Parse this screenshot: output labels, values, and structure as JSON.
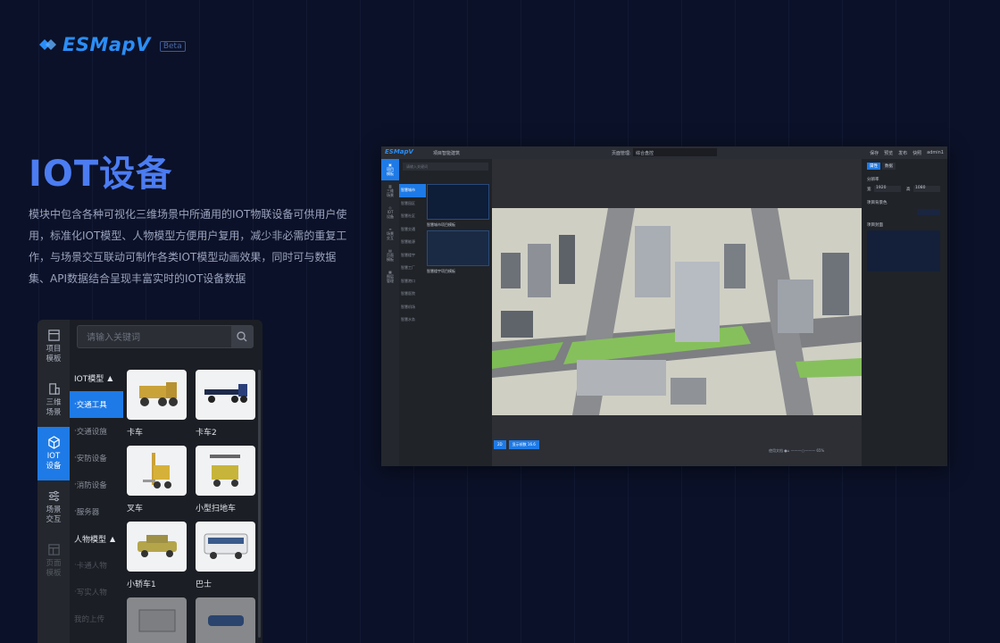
{
  "brand": {
    "name": "ESMapV",
    "badge": "Beta"
  },
  "page": {
    "title": "IOT设备",
    "description": "模块中包含各种可视化三维场景中所通用的IOT物联设备可供用户使用，标准化IOT模型、人物模型方便用户复用，减少非必需的重复工作，与场景交互联动可制作各类IOT模型动画效果，同时可与数据集、API数据结合呈现丰富实时的IOT设备数据"
  },
  "panel": {
    "search_placeholder": "请输入关键词",
    "rail": [
      {
        "label1": "项目",
        "label2": "模板"
      },
      {
        "label1": "三维",
        "label2": "场景"
      },
      {
        "label1": "IOT",
        "label2": "设备"
      },
      {
        "label1": "场景",
        "label2": "交互"
      },
      {
        "label1": "页面",
        "label2": "模板"
      }
    ],
    "groups": {
      "iot": {
        "label": "IOT模型",
        "caret": "▲"
      },
      "people": {
        "label": "人物模型",
        "caret": "▲"
      }
    },
    "iot_items": [
      "交通工具",
      "交通设施",
      "安防设备",
      "消防设备",
      "服务器"
    ],
    "people_items": [
      "卡通人物",
      "写实人物",
      "我的上传"
    ],
    "models": [
      "卡车",
      "卡车2",
      "叉车",
      "小型扫地车",
      "小轿车1",
      "巴士"
    ]
  },
  "app": {
    "logo": "ESMapV",
    "project": "項目智能建筑",
    "scene_label": "页面管理:",
    "scene_value": "综合盘控",
    "top_tools": [
      "保存",
      "预览",
      "发布",
      "快照",
      "admin1"
    ],
    "side_search": "请输入关键词",
    "side_list": [
      "智慧城市",
      "智慧园区",
      "智慧社区",
      "智慧交通",
      "智慧能源",
      "智慧楼宇",
      "智慧工厂",
      "智慧港口",
      "智慧医院",
      "智慧机场",
      "智慧水务"
    ],
    "side_thumb_labels": [
      "智慧城市项目模板",
      "智慧楼宇项目模板"
    ],
    "right_tabs": [
      "属性",
      "数据"
    ],
    "right_props": [
      "分辨率",
      "宽",
      "1920",
      "高",
      "1080",
      "项目背景色",
      "项目封面"
    ],
    "view_buttons": [
      "2D",
      "显示帧数 16.6"
    ],
    "zoom_label": "使用文档",
    "zoom_value": "65%",
    "watermark": "ESMapV"
  },
  "colors": {
    "accent": "#1e7ae6",
    "title": "#4b7cf2",
    "bg": "#0b1128"
  }
}
